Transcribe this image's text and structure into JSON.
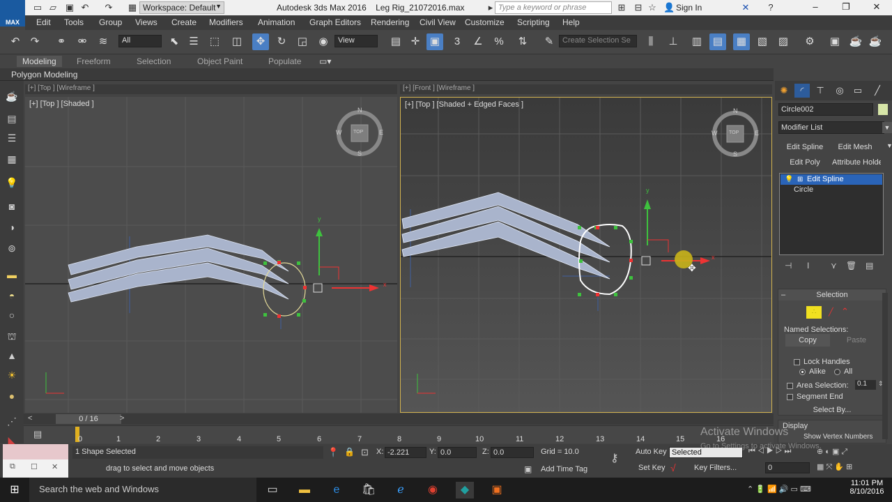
{
  "app": {
    "title": "Autodesk 3ds Max 2016",
    "file": "Leg Rig_21072016.max",
    "logo": "MAX",
    "workspace": "Workspace: Default",
    "search_placeholder": "Type a keyword or phrase",
    "sign_in": "Sign In"
  },
  "menu": [
    "Edit",
    "Tools",
    "Group",
    "Views",
    "Create",
    "Modifiers",
    "Animation",
    "Graph Editors",
    "Rendering",
    "Civil View",
    "Customize",
    "Scripting",
    "Help"
  ],
  "toolbar": {
    "filter": "All",
    "ref_coord": "View",
    "selection_set_placeholder": "Create Selection Se"
  },
  "ribbon": {
    "tabs": [
      "Modeling",
      "Freeform",
      "Selection",
      "Object Paint",
      "Populate"
    ],
    "active_tab": "Modeling",
    "panel": "Polygon Modeling"
  },
  "viewports": {
    "left_strip": "[+] [Top ] [Wireframe ]",
    "right_strip": "[+] [Front ] [Wireframe ]",
    "left_label": "[+] [Top ] [Shaded ]",
    "right_label": "[+] [Top ] [Shaded + Edged Faces ]",
    "viewcube": {
      "n": "N",
      "s": "S",
      "e": "E",
      "w": "W",
      "face": "TOP"
    },
    "axis_x": "x",
    "axis_y": "y"
  },
  "command_panel": {
    "object_name": "Circle002",
    "object_color": "#d7e6a8",
    "modifier_list": "Modifier List",
    "buttons": [
      "Edit Spline",
      "Edit Mesh",
      "Edit Poly",
      "Attribute Holde"
    ],
    "stack": [
      {
        "name": "Edit Spline",
        "selected": true
      },
      {
        "name": "Circle",
        "selected": false
      }
    ],
    "selection_rollout": {
      "title": "Selection",
      "named_selections": "Named Selections:",
      "copy": "Copy",
      "paste": "Paste",
      "lock_handles": "Lock Handles",
      "alike": "Alike",
      "all": "All",
      "area_selection": "Area Selection:",
      "area_value": "0.1",
      "segment_end": "Segment End",
      "select_by": "Select By..."
    },
    "display_rollout": {
      "title": "Display",
      "show_vertex_numbers": "Show Vertex Numbers"
    }
  },
  "timeline": {
    "slider": "0 / 16",
    "ticks": [
      "0",
      "1",
      "2",
      "3",
      "4",
      "5",
      "6",
      "7",
      "8",
      "9",
      "10",
      "11",
      "12",
      "13",
      "14",
      "15",
      "16"
    ]
  },
  "status": {
    "selection": "1 Shape Selected",
    "prompt": "drag to select and move objects",
    "x_value": "-2.221",
    "y_value": "0.0",
    "z_value": "0.0",
    "x_label": "X:",
    "y_label": "Y:",
    "z_label": "Z:",
    "grid": "Grid = 10.0",
    "add_time_tag": "Add Time Tag",
    "auto_key": "Auto Key",
    "set_key": "Set Key",
    "key_mode": "Selected",
    "key_filters": "Key Filters...",
    "frame": "0"
  },
  "watermark": {
    "line1": "Activate Windows",
    "line2": "Go to Settings to activate Windows."
  },
  "taskbar": {
    "search": "Search the web and Windows",
    "time": "11:01 PM",
    "date": "8/10/2016"
  }
}
